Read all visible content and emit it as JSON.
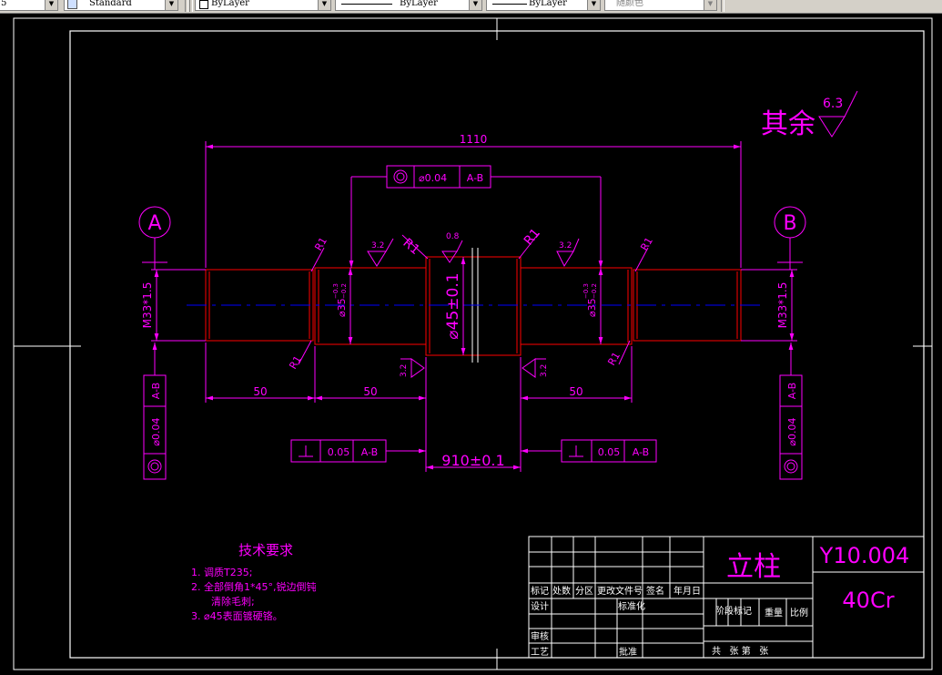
{
  "toolbar": {
    "text_style_partial": "5",
    "dim_style": "Standard",
    "layer": "ByLayer",
    "linetype": "ByLayer",
    "lineweight": "ByLayer",
    "color": "随颜色"
  },
  "drawing": {
    "overall_length": "1110",
    "seg_50_left": "50",
    "seg_50_mid": "50",
    "seg_50_right": "50",
    "center_dim": "910±0.1",
    "center_diameter": "⌀45±0.1",
    "left_thread": "M33*1.5",
    "right_thread": "M33*1.5",
    "left_bearing_dia": "⌀35",
    "left_bearing_tol_upper": "−0.3",
    "left_bearing_tol_lower": "−0.2",
    "right_bearing_dia": "⌀35",
    "right_bearing_tol_upper": "−0.3",
    "right_bearing_tol_lower": "−0.2",
    "radius_label": "R1",
    "datum_a": "A",
    "datum_b": "B",
    "rough_32": "3.2",
    "rough_08": "0.8",
    "rough_other_value": "6.3",
    "rough_other_label": "其余",
    "gdt_coaxial_top": {
      "value": "⌀0.04",
      "datum": "A-B"
    },
    "gdt_coaxial_left": {
      "value": "⌀0.04",
      "datum": "A-B"
    },
    "gdt_coaxial_right": {
      "value": "⌀0.04",
      "datum": "A-B"
    },
    "gdt_perp_left": {
      "value": "0.05",
      "datum": "A-B"
    },
    "gdt_perp_right": {
      "value": "0.05",
      "datum": "A-B"
    }
  },
  "notes": {
    "title": "技术要求",
    "line1": "1.  调质T235;",
    "line2": "2.  全部倒角1*45°,锐边倒钝",
    "line2b": "清除毛刺;",
    "line3": "3.  ⌀45表面镀硬铬。"
  },
  "title_block": {
    "part_name": "立柱",
    "drawing_no": "Y10.004",
    "material": "40Cr",
    "h_mark": "标记",
    "h_count": "处数",
    "h_zone": "分区",
    "h_doc": "更改文件号",
    "h_sign": "签名",
    "h_date": "年月日",
    "r_design": "设计",
    "r_standard": "标准化",
    "r_check": "审核",
    "r_process": "工艺",
    "r_approve": "批准",
    "stage": "阶段标记",
    "weight": "重量",
    "scale": "比例",
    "sheets": "共   张 第   张"
  },
  "colors": {
    "magenta": "#ff00ff",
    "red": "#ff0000",
    "blue": "#0000ff",
    "white": "#ffffff",
    "background": "#000000"
  }
}
